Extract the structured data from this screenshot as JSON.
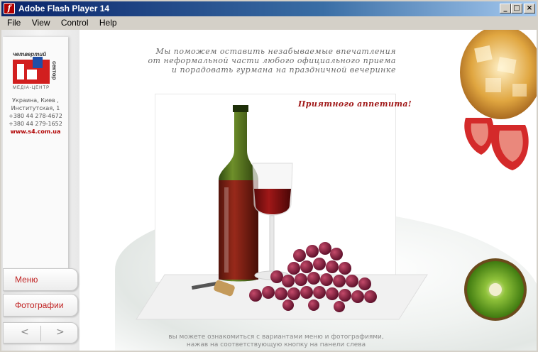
{
  "window": {
    "title": "Adobe Flash Player 14",
    "app_icon_glyph": "f",
    "minimize": "_",
    "maximize": "□",
    "close": "×"
  },
  "menu": [
    "File",
    "View",
    "Control",
    "Help"
  ],
  "logo": {
    "top_text": "четвертий",
    "side_text": "сектор",
    "bottom_text": "МЕДІА-ЦЕНТР",
    "colors": {
      "red": "#d21f1f",
      "blue": "#1f4fa8"
    }
  },
  "contact": {
    "line1": "Украина, Киев ,",
    "line2": "Институтская, 1",
    "phone1": "+380 44 278-4672",
    "phone2": "+380 44 279-1652",
    "site": "www.s4.com.ua"
  },
  "nav": {
    "menu_label": "Меню",
    "photos_label": "Фотографии",
    "prev": "<",
    "next": ">"
  },
  "headline": {
    "line1": "Мы поможем оставить незабываемые впечатления",
    "line2": "от неформальной части любого официального приема",
    "line3": "и порадовать гурмана на праздничной вечеринке"
  },
  "photo_caption": "Приятного аппетита!",
  "footer": {
    "line1": "вы можете ознакомиться с вариантами меню и фотографиями,",
    "line2": "нажав на соответствующую кнопку на панели слева"
  },
  "colors": {
    "accent_red": "#b00000",
    "title_bar": "#0a246a"
  }
}
